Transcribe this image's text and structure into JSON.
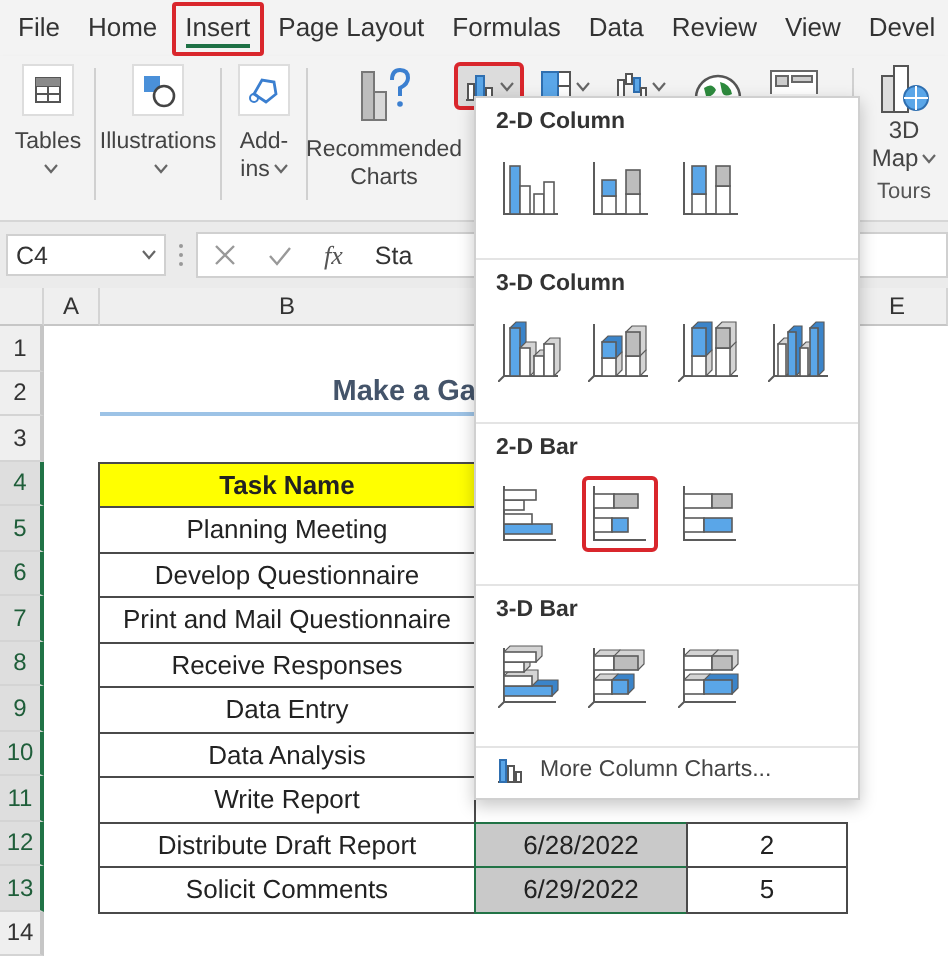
{
  "ribbon_tabs": [
    {
      "label": "File",
      "selected": false
    },
    {
      "label": "Home",
      "selected": false
    },
    {
      "label": "Insert",
      "selected": true
    },
    {
      "label": "Page Layout",
      "selected": false
    },
    {
      "label": "Formulas",
      "selected": false
    },
    {
      "label": "Data",
      "selected": false
    },
    {
      "label": "Review",
      "selected": false
    },
    {
      "label": "View",
      "selected": false
    },
    {
      "label": "Devel",
      "selected": false
    }
  ],
  "ribbon_commands": [
    {
      "kind": "tables",
      "label": "Tables"
    },
    {
      "kind": "illustrations",
      "label": "Illustrations"
    },
    {
      "kind": "addins",
      "label": "Add-ins"
    },
    {
      "kind": "recommended",
      "label": "Recommended Charts"
    }
  ],
  "chart_buttons": [
    {
      "kind": "column",
      "selected": true
    },
    {
      "kind": "hierarchy",
      "selected": false
    },
    {
      "kind": "waterfall",
      "selected": false
    },
    {
      "kind": "maps",
      "selected": false
    },
    {
      "kind": "pivot",
      "selected": false
    }
  ],
  "tours": {
    "button": "3D Map",
    "group": "Tours"
  },
  "formula_bar": {
    "name_box": "C4",
    "function_label": "fx",
    "value": "Sta"
  },
  "column_headers": [
    "A",
    "B",
    "E"
  ],
  "row_headers": [
    {
      "label": "1",
      "selected": false
    },
    {
      "label": "2",
      "selected": false
    },
    {
      "label": "3",
      "selected": false
    },
    {
      "label": "4",
      "selected": true
    },
    {
      "label": "5",
      "selected": true
    },
    {
      "label": "6",
      "selected": true
    },
    {
      "label": "7",
      "selected": true
    },
    {
      "label": "8",
      "selected": true
    },
    {
      "label": "9",
      "selected": true
    },
    {
      "label": "10",
      "selected": true
    },
    {
      "label": "11",
      "selected": true
    },
    {
      "label": "12",
      "selected": true
    },
    {
      "label": "13",
      "selected": true
    },
    {
      "label": "14",
      "selected": false
    }
  ],
  "sheet": {
    "title": "Make a Ga",
    "table_header": "Task Name",
    "tasks": [
      {
        "name": "Planning Meeting"
      },
      {
        "name": "Develop Questionnaire"
      },
      {
        "name": "Print and Mail Questionnaire"
      },
      {
        "name": "Receive Responses"
      },
      {
        "name": "Data Entry"
      },
      {
        "name": "Data Analysis"
      },
      {
        "name": "Write Report"
      },
      {
        "name": "Distribute Draft Report",
        "start": "6/28/2022",
        "duration": "2"
      },
      {
        "name": "Solicit Comments",
        "start": "6/29/2022",
        "duration": "5"
      }
    ]
  },
  "chart_menu": {
    "sections": [
      {
        "title": "2-D Column",
        "kind": "column-2d",
        "items": [
          {
            "kind": "clustered",
            "selected": false
          },
          {
            "kind": "stacked",
            "selected": false
          },
          {
            "kind": "percent",
            "selected": false
          }
        ]
      },
      {
        "title": "3-D Column",
        "kind": "column-3d",
        "items": [
          {
            "kind": "clustered",
            "selected": false
          },
          {
            "kind": "stacked",
            "selected": false
          },
          {
            "kind": "percent",
            "selected": false
          },
          {
            "kind": "standalone",
            "selected": false
          }
        ]
      },
      {
        "title": "2-D Bar",
        "kind": "bar-2d",
        "items": [
          {
            "kind": "clustered",
            "selected": false
          },
          {
            "kind": "stacked",
            "selected": true
          },
          {
            "kind": "percent",
            "selected": false
          }
        ]
      },
      {
        "title": "3-D Bar",
        "kind": "bar-3d",
        "items": [
          {
            "kind": "clustered",
            "selected": false
          },
          {
            "kind": "stacked",
            "selected": false
          },
          {
            "kind": "percent",
            "selected": false
          }
        ]
      }
    ],
    "more_link": "More Column Charts..."
  }
}
